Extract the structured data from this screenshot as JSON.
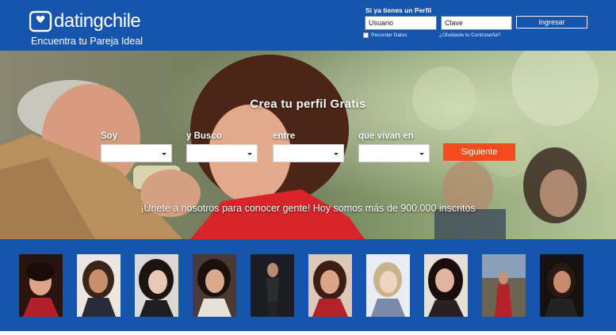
{
  "brand": {
    "name": "datingchile",
    "tagline": "Encuentra tu Pareja Ideal"
  },
  "login": {
    "title": "Si ya tienes un Perfil",
    "username_value": "Usuario",
    "password_value": "Clave",
    "submit_label": "Ingresar",
    "remember_label": "Recordar Datos",
    "forgot_label": "¿Olvidaste tu Contraseña?"
  },
  "hero": {
    "title": "Crea tu perfil Gratis",
    "fields": [
      {
        "label": "Soy",
        "value": ""
      },
      {
        "label": "y Busco",
        "value": ""
      },
      {
        "label": "entre",
        "value": ""
      },
      {
        "label": "que vivan en",
        "value": ""
      }
    ],
    "next_label": "Siguiente",
    "subtitle": "¡Únete a nosotros para conocer gente! Hoy somos más de 900.000 inscritos"
  },
  "profiles": [
    {
      "photo": "profile-photo-1"
    },
    {
      "photo": "profile-photo-2"
    },
    {
      "photo": "profile-photo-3"
    },
    {
      "photo": "profile-photo-4"
    },
    {
      "photo": "profile-photo-5"
    },
    {
      "photo": "profile-photo-6"
    },
    {
      "photo": "profile-photo-7"
    },
    {
      "photo": "profile-photo-8"
    },
    {
      "photo": "profile-photo-9"
    },
    {
      "photo": "profile-photo-10"
    }
  ],
  "colors": {
    "brand_blue": "#1655ad",
    "cta_orange": "#f44a1c",
    "white": "#ffffff"
  }
}
